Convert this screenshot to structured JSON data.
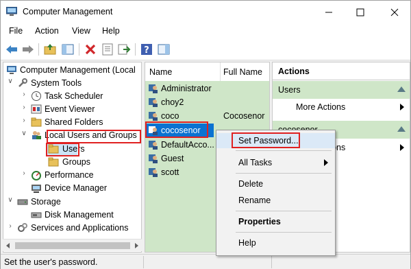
{
  "window": {
    "title": "Computer Management",
    "controls": {
      "minimize": "minimize-icon",
      "maximize": "maximize-icon",
      "close": "close-icon"
    }
  },
  "menu": [
    "File",
    "Action",
    "View",
    "Help"
  ],
  "toolbar": {
    "icons": [
      "back-arrow-icon",
      "forward-arrow-icon",
      "up-folder-icon",
      "show-hide-tree-icon",
      "delete-icon",
      "properties-icon",
      "export-icon",
      "help-icon",
      "action-pane-icon"
    ]
  },
  "tree": {
    "root": "Computer Management (Local",
    "system_tools": "System Tools",
    "task_scheduler": "Task Scheduler",
    "event_viewer": "Event Viewer",
    "shared_folders": "Shared Folders",
    "local_users_groups": "Local Users and Groups",
    "users": "Users",
    "groups": "Groups",
    "performance": "Performance",
    "device_manager": "Device Manager",
    "storage": "Storage",
    "disk_management": "Disk Management",
    "services_apps": "Services and Applications"
  },
  "list": {
    "col_name": "Name",
    "col_full_name": "Full Name",
    "rows": [
      {
        "name": "Administrator",
        "full": ""
      },
      {
        "name": "choy2",
        "full": ""
      },
      {
        "name": "coco",
        "full": "Cocosenor"
      },
      {
        "name": "cocosenor",
        "full": ""
      },
      {
        "name": "DefaultAcco...",
        "full": ""
      },
      {
        "name": "Guest",
        "full": ""
      },
      {
        "name": "scott",
        "full": ""
      }
    ]
  },
  "actions": {
    "header": "Actions",
    "section1": "Users",
    "more_actions": "More Actions",
    "section2": "cocosenor",
    "more_actions2": "More Actions"
  },
  "context_menu": {
    "set_password": "Set Password...",
    "all_tasks": "All Tasks",
    "delete": "Delete",
    "rename": "Rename",
    "properties": "Properties",
    "help": "Help"
  },
  "status": "Set the user's password.",
  "colors": {
    "highlight_box": "#e02020",
    "selection_blue": "#0a72d1",
    "pane_green": "#cfe6c8"
  }
}
